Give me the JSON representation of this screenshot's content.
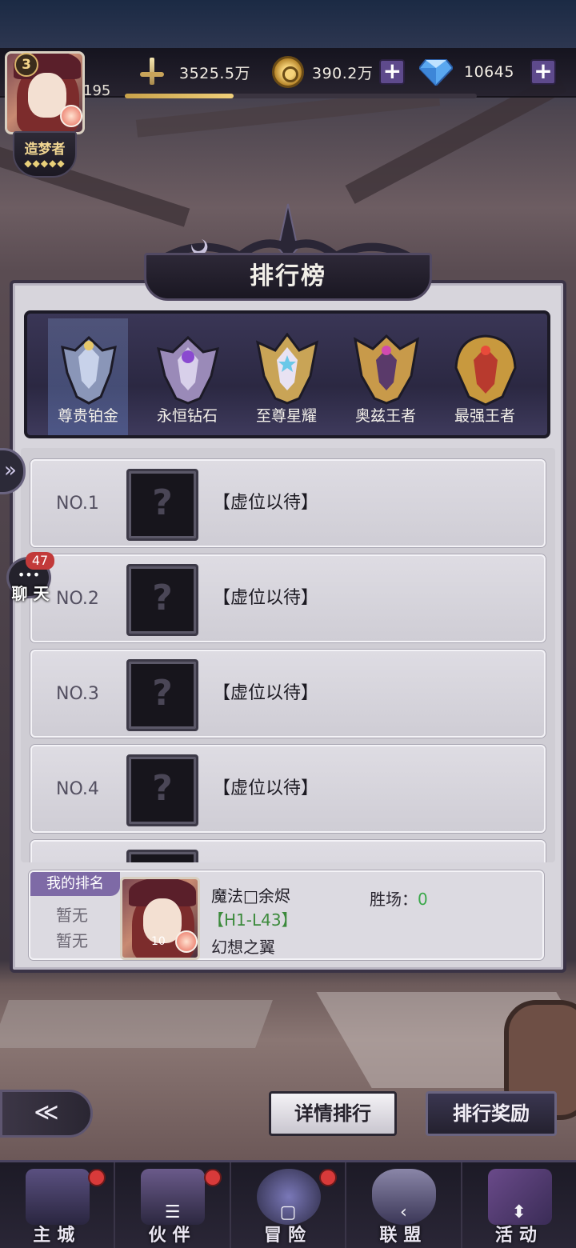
{
  "player": {
    "level": "3",
    "power": "195",
    "title": "造梦者",
    "title_stars": "◆◆◆◆◆"
  },
  "resources": {
    "power_total": "3525.5万",
    "gold": "390.2万",
    "diamonds": "10645",
    "xp_progress": 0.31
  },
  "panel": {
    "title": "排行榜",
    "tiers": [
      {
        "label": "尊贵铂金",
        "active": true
      },
      {
        "label": "永恒钻石",
        "active": false
      },
      {
        "label": "至尊星耀",
        "active": false
      },
      {
        "label": "奥兹王者",
        "active": false
      },
      {
        "label": "最强王者",
        "active": false
      }
    ],
    "rows": [
      {
        "rank": "NO.1",
        "name": "【虚位以待】"
      },
      {
        "rank": "NO.2",
        "name": "【虚位以待】"
      },
      {
        "rank": "NO.3",
        "name": "【虚位以待】"
      },
      {
        "rank": "NO.4",
        "name": "【虚位以待】"
      }
    ],
    "my_rank": {
      "tag": "我的排名",
      "rank_value": "暂无",
      "tier_value": "暂无",
      "name": "魔法□余烬",
      "server": "【H1-L43】",
      "guild": "幻想之翼",
      "wins_label": "胜场：",
      "wins": "0",
      "portrait_level": "10"
    }
  },
  "side": {
    "chat_count": "47",
    "chat_label": "聊 天"
  },
  "buttons": {
    "detail": "详情排行",
    "rewards": "排行奖励"
  },
  "nav": [
    {
      "label": "主城",
      "badge": true,
      "sys": ""
    },
    {
      "label": "伙伴",
      "badge": true,
      "sys": "☰"
    },
    {
      "label": "冒险",
      "badge": true,
      "sys": "▢"
    },
    {
      "label": "联盟",
      "badge": false,
      "sys": "‹"
    },
    {
      "label": "活动",
      "badge": false,
      "sys": "⬍"
    }
  ],
  "colors": {
    "panel_bg": "#d7d5dc",
    "active_tab": "#7a8cc0",
    "badge_red": "#d83a3a",
    "wins_green": "#3aa84a",
    "server_green": "#3c8a3c"
  }
}
